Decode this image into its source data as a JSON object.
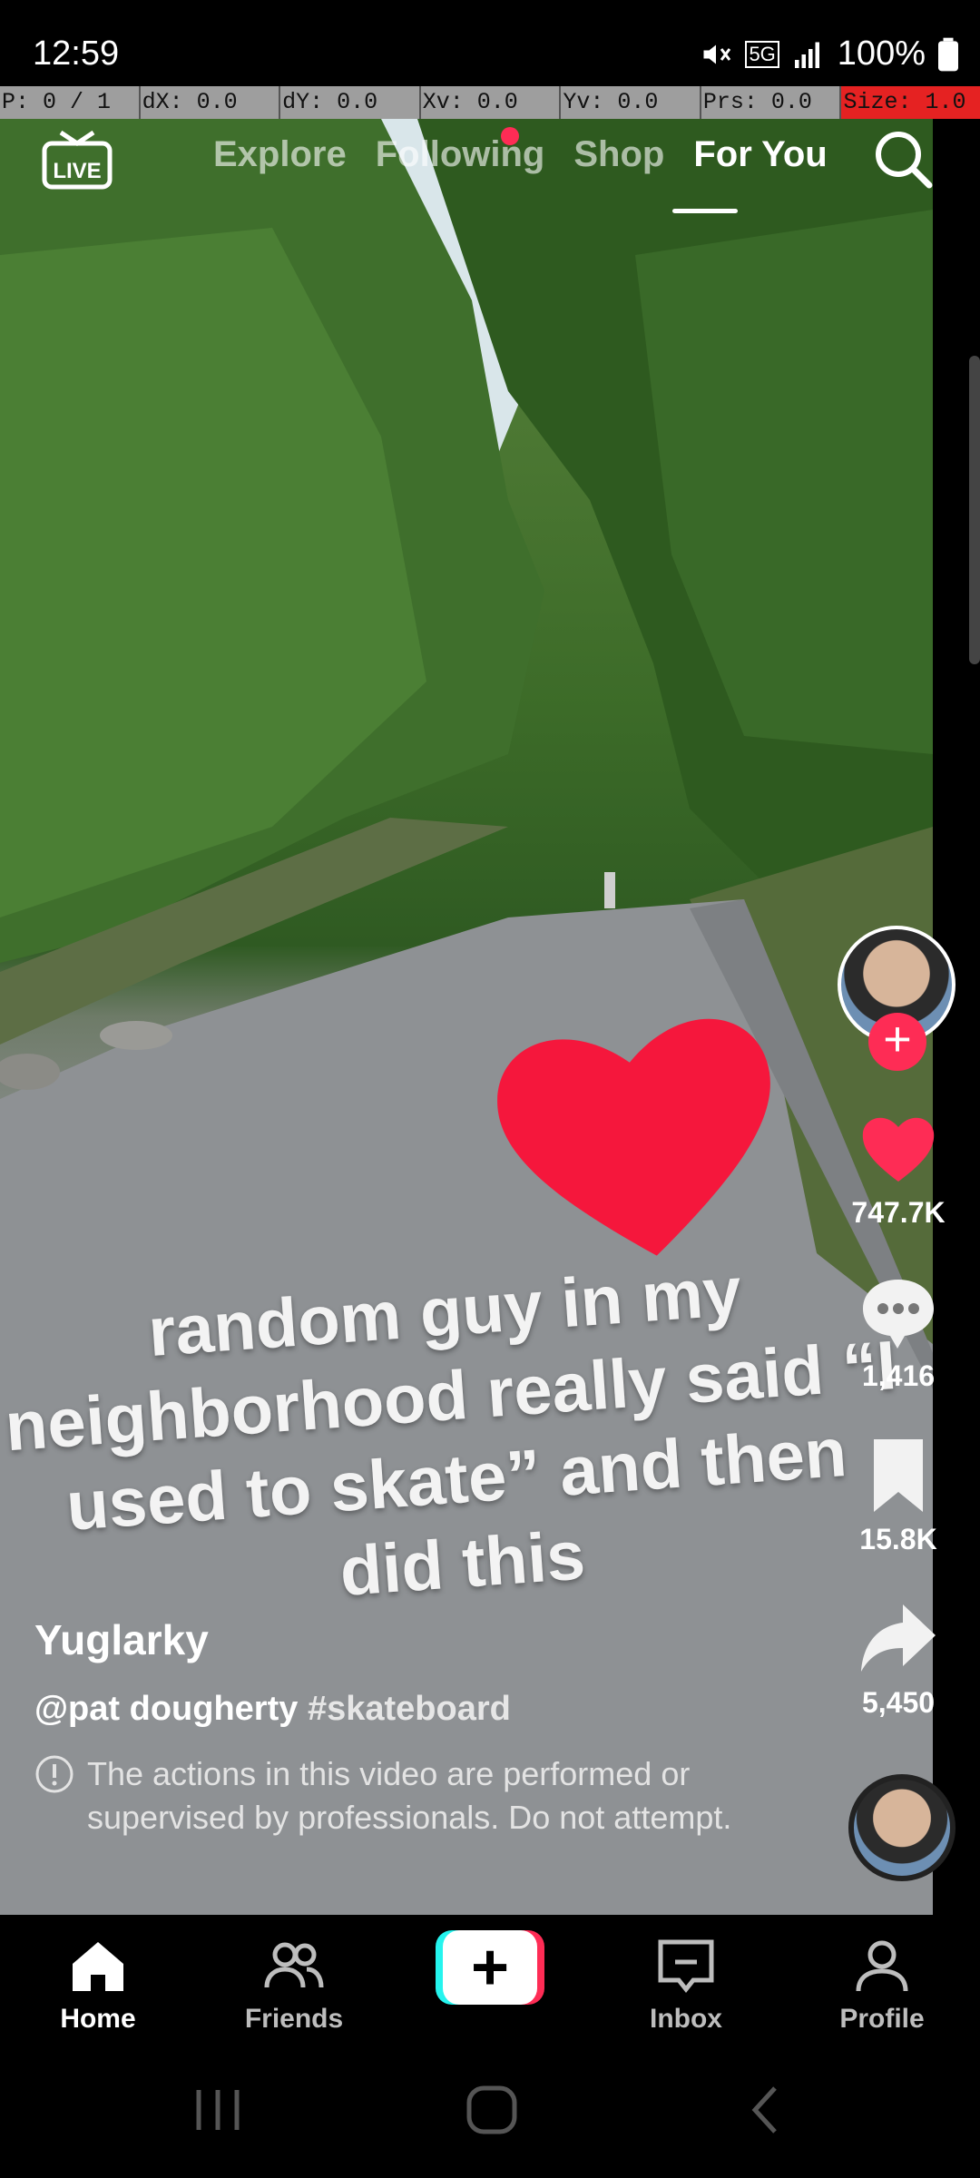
{
  "status_bar": {
    "time": "12:59",
    "battery": "100%",
    "network": "5G"
  },
  "debug_bar": [
    {
      "label": "P: 0 / 1"
    },
    {
      "label": "dX: 0.0"
    },
    {
      "label": "dY: 0.0"
    },
    {
      "label": "Xv: 0.0"
    },
    {
      "label": "Yv: 0.0"
    },
    {
      "label": "Prs: 0.0"
    },
    {
      "label": "Size: 1.0"
    }
  ],
  "top_nav": {
    "live_label": "LIVE",
    "tabs": [
      {
        "label": "Explore"
      },
      {
        "label": "Following"
      },
      {
        "label": "Shop"
      },
      {
        "label": "For You"
      }
    ],
    "active_tab": "For You"
  },
  "video": {
    "caption_lines": [
      "random guy in my",
      "neighborhood really said “I",
      "used to skate” and then",
      "did this"
    ]
  },
  "actions": {
    "likes": "747.7K",
    "comments": "1,416",
    "saves": "15.8K",
    "shares": "5,450"
  },
  "post": {
    "username": "Yuglarky",
    "mention": "@pat dougherty",
    "hashtag": "#skateboard",
    "warning": "The actions in this video are performed or supervised by professionals. Do not attempt."
  },
  "bottom_nav": [
    {
      "label": "Home"
    },
    {
      "label": "Friends"
    },
    {
      "label": "Create"
    },
    {
      "label": "Inbox"
    },
    {
      "label": "Profile"
    }
  ],
  "colors": {
    "accent": "#fe2c55",
    "cyan": "#25f4ee",
    "debug_alert": "#e52222"
  },
  "icons": [
    "live-icon",
    "search-icon",
    "heart-icon",
    "comment-icon",
    "bookmark-icon",
    "share-icon",
    "home-icon",
    "friends-icon",
    "inbox-icon",
    "profile-icon",
    "warning-icon"
  ]
}
